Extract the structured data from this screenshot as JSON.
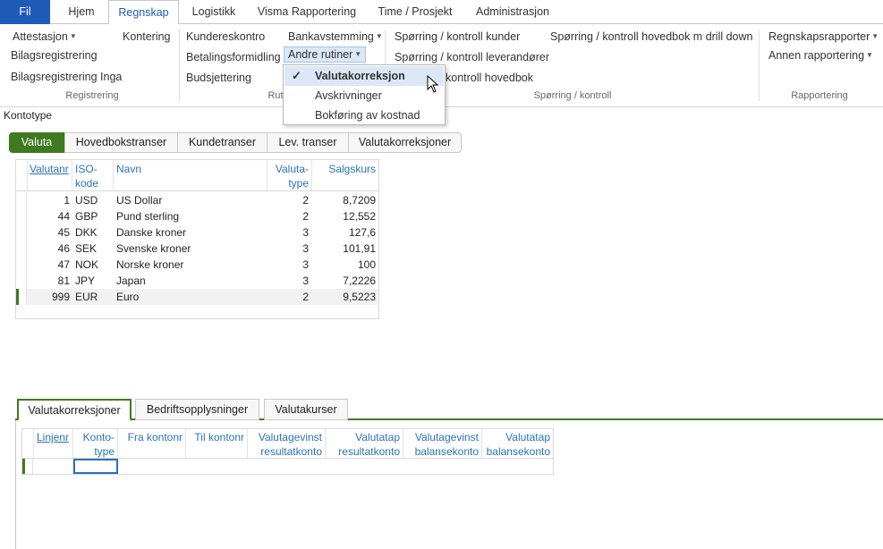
{
  "ribbon_tabs": [
    "Fil",
    "Hjem",
    "Regnskap",
    "Logistikk",
    "Visma Rapportering",
    "Time / Prosjekt",
    "Administrasjon"
  ],
  "ribbon": {
    "attestasjon": "Attestasjon",
    "bilagsregistrering": "Bilagsregistrering",
    "bilagsregistrering_inga": "Bilagsregistrering Inga",
    "kontering": "Kontering",
    "group_registrering": "Registrering",
    "kundereskontro": "Kundereskontro",
    "betalingsformidling": "Betalingsformidling",
    "budsjettering": "Budsjettering",
    "bankavstemming": "Bankavstemming",
    "andre_rutiner": "Andre rutiner",
    "group_rutiner_partial": "Rut",
    "sporring_kunder": "Spørring / kontroll kunder",
    "sporring_leverandorer": "Spørring / kontroll leverandører",
    "sporring_hovedbok_partial": "kontroll hovedbok",
    "sporring_drill": "Spørring / kontroll hovedbok m drill down",
    "group_sporring": "Spørring / kontroll",
    "regnskapsrapporter": "Regnskapsrapporter",
    "annen_rapportering": "Annen rapportering",
    "group_rapportering": "Rapportering"
  },
  "dropdown_items": [
    "Valutakorreksjon",
    "Avskrivninger",
    "Bokføring av kostnad"
  ],
  "kontotype_label": "Kontotype",
  "top_tabs": [
    "Valuta",
    "Hovedbokstranser",
    "Kundetranser",
    "Lev. transer",
    "Valutakorreksjoner"
  ],
  "currency_grid": {
    "headers": {
      "valutanr": "Valutanr",
      "iso_1": "ISO-",
      "iso_2": "kode",
      "navn": "Navn",
      "valutatype_1": "Valuta-",
      "valutatype_2": "type",
      "salgskurs": "Salgskurs"
    },
    "rows": [
      {
        "nr": "1",
        "iso": "USD",
        "navn": "US Dollar",
        "type": "2",
        "kurs": "8,7209"
      },
      {
        "nr": "44",
        "iso": "GBP",
        "navn": "Pund sterling",
        "type": "2",
        "kurs": "12,552"
      },
      {
        "nr": "45",
        "iso": "DKK",
        "navn": "Danske kroner",
        "type": "3",
        "kurs": "127,6"
      },
      {
        "nr": "46",
        "iso": "SEK",
        "navn": "Svenske kroner",
        "type": "3",
        "kurs": "101,91"
      },
      {
        "nr": "47",
        "iso": "NOK",
        "navn": "Norske kroner",
        "type": "3",
        "kurs": "100"
      },
      {
        "nr": "81",
        "iso": "JPY",
        "navn": "Japan",
        "type": "3",
        "kurs": "7,2226"
      },
      {
        "nr": "999",
        "iso": "EUR",
        "navn": "Euro",
        "type": "2",
        "kurs": "9,5223"
      }
    ]
  },
  "bottom_tabs": [
    "Valutakorreksjoner",
    "Bedriftsopplysninger",
    "Valutakurser"
  ],
  "korr_grid": {
    "linjenr": "Linjenr",
    "kontotype_1": "Konto-",
    "kontotype_2": "type",
    "fra": "Fra kontonr",
    "til": "Til kontonr",
    "gev_res_1": "Valutagevinst",
    "gev_res_2": "resultatkonto",
    "tap_res_1": "Valutatap",
    "tap_res_2": "resultatkonto",
    "gev_bal_1": "Valutagevinst",
    "gev_bal_2": "balansekonto",
    "tap_bal_1": "Valutatap",
    "tap_bal_2": "balansekonto"
  },
  "colors": {
    "accent_blue": "#1e5bb8",
    "accent_green": "#3f7a1f",
    "header_text": "#2a74b8"
  }
}
